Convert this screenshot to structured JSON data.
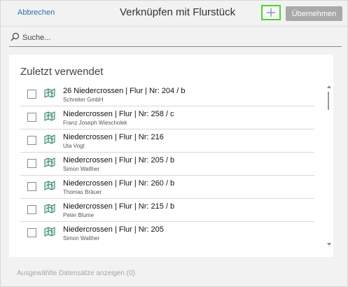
{
  "header": {
    "cancel_label": "Abbrechen",
    "title": "Verknüpfen mit Flurstück",
    "add_symbol": "+",
    "apply_label": "Übernehmen"
  },
  "search": {
    "placeholder": "Suche..."
  },
  "recent": {
    "title": "Zuletzt verwendet",
    "items": [
      {
        "line1": "26 Niedercrossen | Flur | Nr: 204 / b",
        "line2": "Schreiter GmbH"
      },
      {
        "line1": "Niedercrossen | Flur | Nr: 258 / c",
        "line2": "Franz Joseph Wiescholek"
      },
      {
        "line1": "Niedercrossen | Flur | Nr: 216",
        "line2": "Uta Vogt"
      },
      {
        "line1": "Niedercrossen | Flur | Nr: 205 / b",
        "line2": "Simon Walther"
      },
      {
        "line1": "Niedercrossen | Flur | Nr: 260 / b",
        "line2": "Thomas Bräuer"
      },
      {
        "line1": "Niedercrossen | Flur | Nr: 215 / b",
        "line2": "Peter Blume"
      },
      {
        "line1": "Niedercrossen | Flur | Nr: 205",
        "line2": "Simon Walther"
      }
    ]
  },
  "footer": {
    "show_selected_label": "Ausgewählte Datensätze anzeigen (0)"
  },
  "colors": {
    "link": "#2c6fb7",
    "add_border": "#4ed335",
    "apply_bg": "#a9a9a9",
    "icon_green": "#2e7d5b"
  },
  "icons": {
    "add": "plus-icon",
    "search": "search-icon",
    "item": "parcel-map-icon"
  }
}
